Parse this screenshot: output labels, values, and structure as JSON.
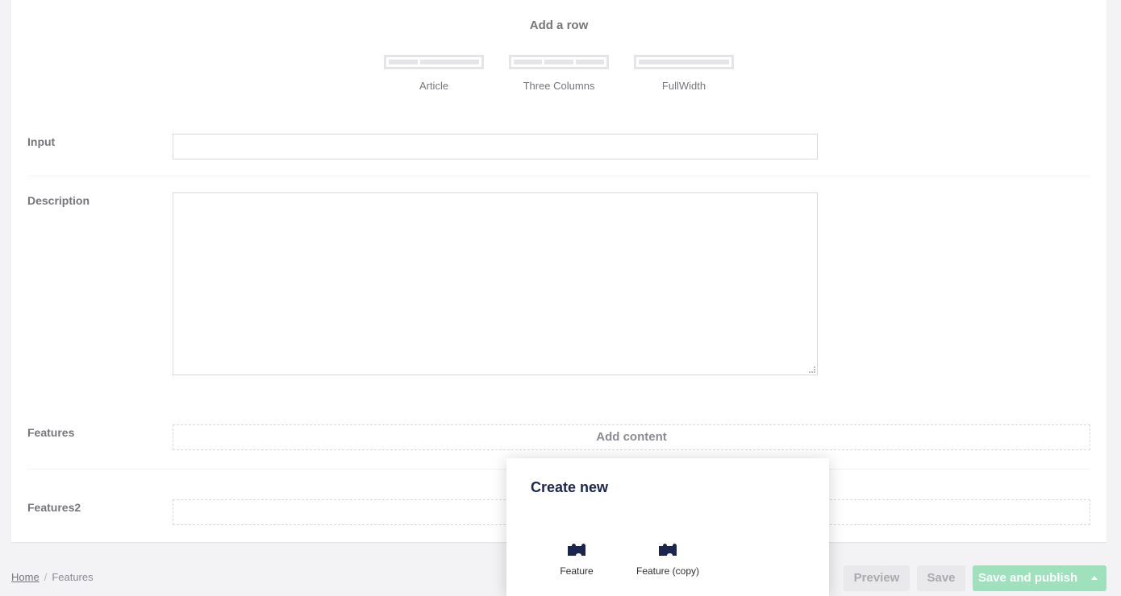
{
  "add_row": {
    "title": "Add a row",
    "layouts": [
      {
        "label": "Article",
        "icon": "layout-article-icon"
      },
      {
        "label": "Three Columns",
        "icon": "layout-three-columns-icon"
      },
      {
        "label": "FullWidth",
        "icon": "layout-fullwidth-icon"
      }
    ]
  },
  "properties": {
    "input": {
      "label": "Input",
      "value": ""
    },
    "description": {
      "label": "Description",
      "value": ""
    },
    "features": {
      "label": "Features",
      "add_label": "Add content"
    },
    "features2": {
      "label": "Features2",
      "add_label": ""
    }
  },
  "modal": {
    "title": "Create new",
    "items": [
      {
        "label": "Feature",
        "icon": "puzzle-icon"
      },
      {
        "label": "Feature (copy)",
        "icon": "puzzle-icon"
      }
    ]
  },
  "footer": {
    "breadcrumb": {
      "home": "Home",
      "separator": "/",
      "current": "Features"
    },
    "buttons": {
      "preview": "Preview",
      "save": "Save",
      "publish": "Save and publish"
    }
  },
  "colors": {
    "accent": "#1b264f",
    "publish": "#9fe0bd",
    "background": "#f3f3f5"
  }
}
